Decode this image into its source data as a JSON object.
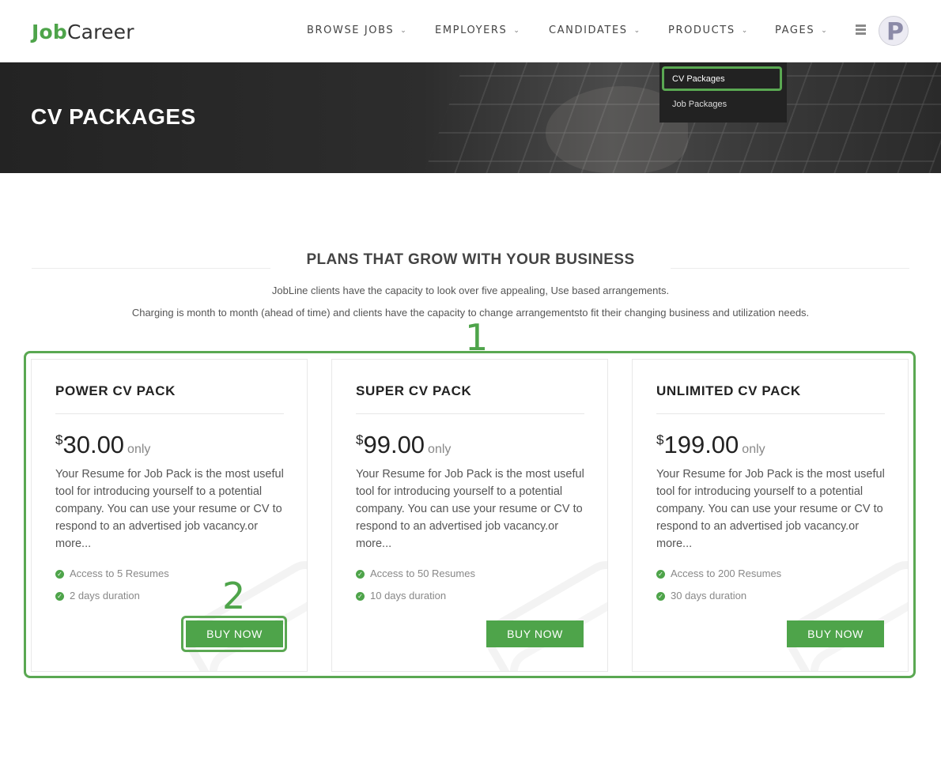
{
  "logo": {
    "part1": "Job",
    "part2": "Career"
  },
  "nav": [
    {
      "label": "BROWSE JOBS"
    },
    {
      "label": "EMPLOYERS"
    },
    {
      "label": "CANDIDATES"
    },
    {
      "label": "PRODUCTS"
    },
    {
      "label": "PAGES"
    }
  ],
  "nav_chevron": "⌄",
  "avatar_letter": "P",
  "banner": {
    "title": "CV PACKAGES"
  },
  "dropdown": [
    {
      "label": "CV Packages"
    },
    {
      "label": "Job Packages"
    }
  ],
  "section": {
    "title": "PLANS THAT GROW WITH YOUR BUSINESS",
    "line1": "JobLine clients have the capacity to look over five appealing, Use based arrangements.",
    "line2": "Charging is month to month (ahead of time) and clients have the capacity to change arrangementsto fit their changing business and utilization needs."
  },
  "annotations": {
    "one": "1",
    "two": "2"
  },
  "cards": [
    {
      "title": "POWER CV PACK",
      "currency": "$",
      "amount": "30.00",
      "only": "only",
      "description": "Your Resume for Job Pack is the most useful tool for introducing yourself to a potential company. You can use your resume or CV to respond to an advertised job vacancy.or more...",
      "features": [
        "Access to 5 Resumes",
        "2 days duration"
      ],
      "button": "BUY NOW"
    },
    {
      "title": "SUPER CV PACK",
      "currency": "$",
      "amount": "99.00",
      "only": "only",
      "description": "Your Resume for Job Pack is the most useful tool for introducing yourself to a potential company. You can use your resume or CV to respond to an advertised job vacancy.or more...",
      "features": [
        "Access to 50 Resumes",
        "10 days duration"
      ],
      "button": "BUY NOW"
    },
    {
      "title": "UNLIMITED CV PACK",
      "currency": "$",
      "amount": "199.00",
      "only": "only",
      "description": "Your Resume for Job Pack is the most useful tool for introducing yourself to a potential company. You can use your resume or CV to respond to an advertised job vacancy.or more...",
      "features": [
        "Access to 200 Resumes",
        "30 days duration"
      ],
      "button": "BUY NOW"
    }
  ],
  "colors": {
    "accent": "#4ea44a",
    "dark": "#222222",
    "banner": "#2b2b2b"
  }
}
